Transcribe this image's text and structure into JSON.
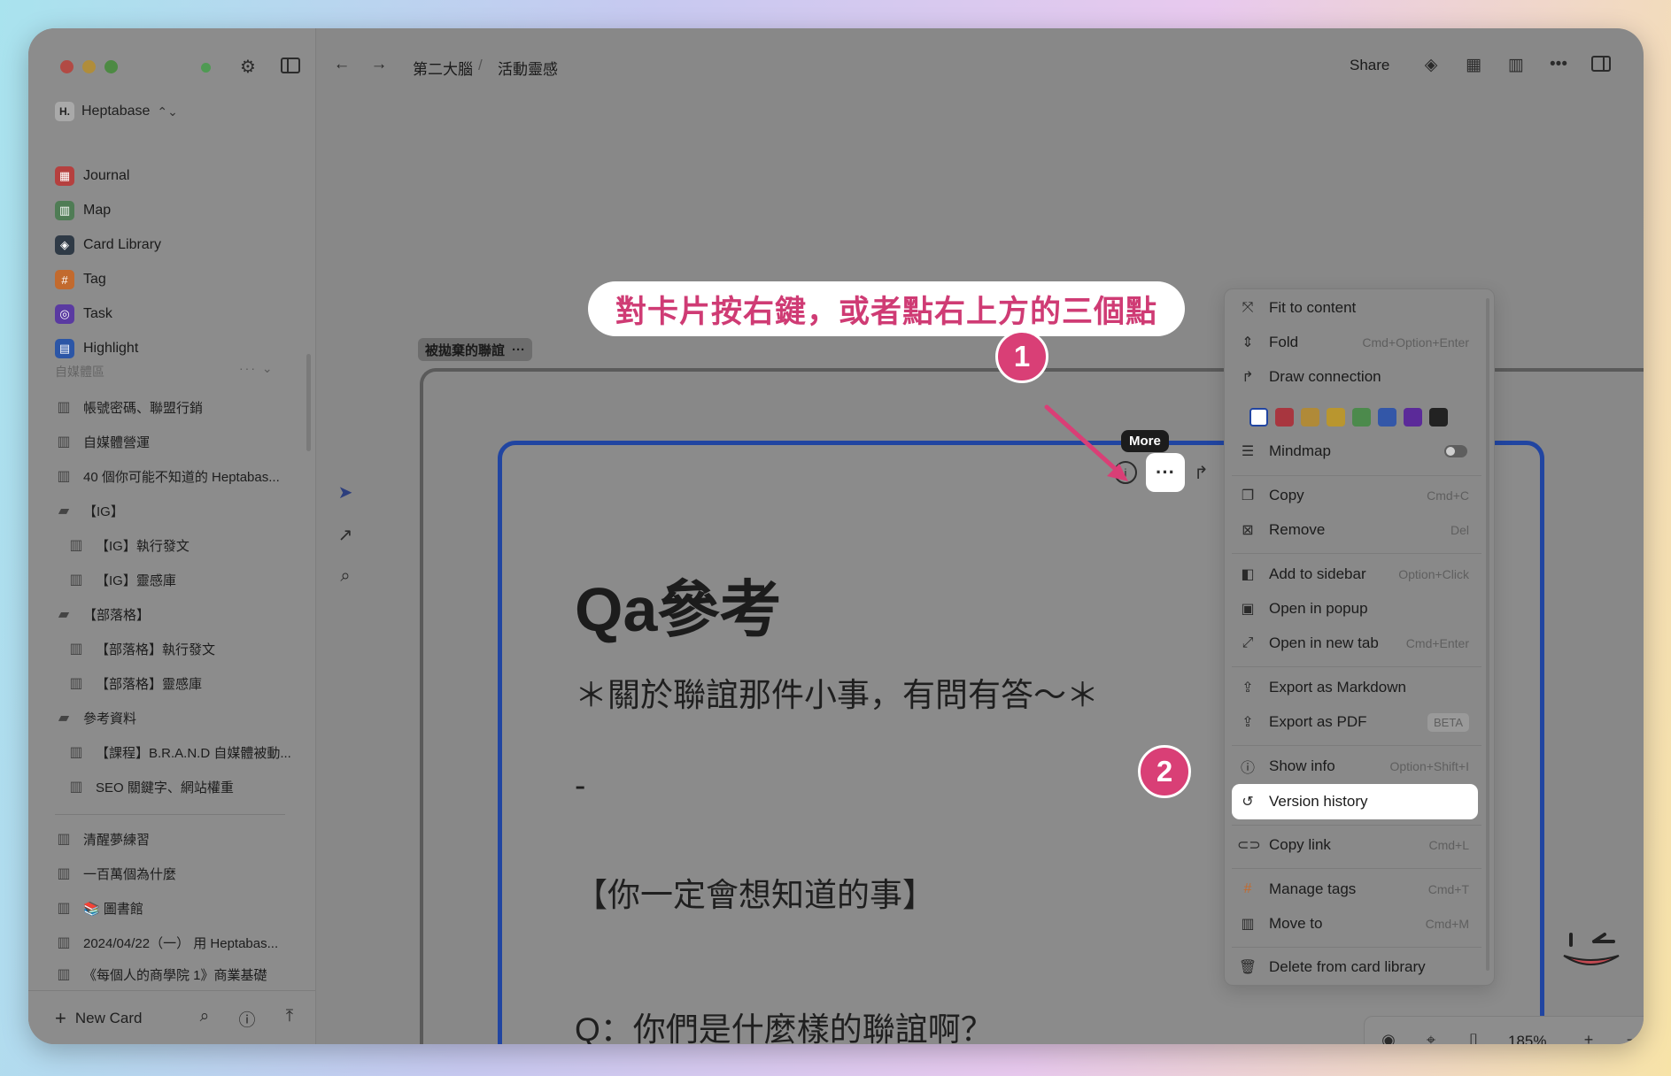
{
  "sidebar": {
    "workspace": {
      "logo": "H.",
      "name": "Heptabase"
    },
    "nav": [
      {
        "label": "Journal",
        "icon": "calendar-icon",
        "color": "#b5403f"
      },
      {
        "label": "Map",
        "icon": "map-icon",
        "color": "#4f7c55"
      },
      {
        "label": "Card Library",
        "icon": "layers-icon",
        "color": "#2f3a46"
      },
      {
        "label": "Tag",
        "icon": "hash-icon",
        "color": "#c26a2e"
      },
      {
        "label": "Task",
        "icon": "check-circle-icon",
        "color": "#5a3aa1"
      },
      {
        "label": "Highlight",
        "icon": "highlight-icon",
        "color": "#2c56a6"
      }
    ],
    "section_title": "自媒體區",
    "section_tools": "···",
    "tree": [
      {
        "label": "帳號密碼、聯盟行銷",
        "type": "card"
      },
      {
        "label": "自媒體營運",
        "type": "card"
      },
      {
        "label": "40 個你可能不知道的 Heptabas...",
        "type": "card"
      },
      {
        "label": "【IG】",
        "type": "folder"
      },
      {
        "label": "【IG】執行發文",
        "type": "card"
      },
      {
        "label": "【IG】靈感庫",
        "type": "card"
      },
      {
        "label": "【部落格】",
        "type": "folder"
      },
      {
        "label": "【部落格】執行發文",
        "type": "card"
      },
      {
        "label": "【部落格】靈感庫",
        "type": "card"
      },
      {
        "label": "參考資料",
        "type": "folder"
      },
      {
        "label": "【課程】B.R.A.N.D 自媒體被動...",
        "type": "card"
      },
      {
        "label": "SEO 關鍵字、網站權重",
        "type": "card"
      },
      {
        "label": "清醒夢練習",
        "type": "card"
      },
      {
        "label": "一百萬個為什麼",
        "type": "card"
      },
      {
        "label": "📚 圖書館",
        "type": "card"
      },
      {
        "label": "2024/04/22（一） 用 Heptabas...",
        "type": "card"
      },
      {
        "label": "《每個人的商學院 1》商業基礎",
        "type": "card"
      }
    ],
    "footer": {
      "new_card": "New Card"
    }
  },
  "header": {
    "breadcrumb": [
      "第二大腦",
      "活動靈感"
    ],
    "breadcrumb_sep": "/",
    "share": "Share"
  },
  "canvas": {
    "banner": "對卡片按右鍵，或者點右上方的三個點",
    "group_label": "被拋棄的聯誼",
    "group_more": "···",
    "card": {
      "title": "Qa參考",
      "lines": [
        "＊關於聯誼那件小事，有問有答～＊",
        "-",
        "【你一定會想知道的事】",
        "Q：你們是什麼樣的聯誼啊？"
      ]
    },
    "tooltip": "More",
    "more_glyph": "···",
    "callouts": [
      "1",
      "2"
    ]
  },
  "context_menu": {
    "items": [
      {
        "label": "Fit to content",
        "shortcut": "",
        "icon": "fit-icon"
      },
      {
        "label": "Fold",
        "shortcut": "Cmd+Option+Enter",
        "icon": "fold-icon"
      },
      {
        "label": "Draw connection",
        "shortcut": "",
        "icon": "connection-icon"
      },
      {
        "label": "Mindmap",
        "shortcut": "",
        "icon": "mindmap-icon"
      },
      {
        "label": "Copy",
        "shortcut": "Cmd+C",
        "icon": "copy-icon"
      },
      {
        "label": "Remove",
        "shortcut": "Del",
        "icon": "remove-icon"
      },
      {
        "label": "Add to sidebar",
        "shortcut": "Option+Click",
        "icon": "sidebar-add-icon"
      },
      {
        "label": "Open in popup",
        "shortcut": "",
        "icon": "popup-icon"
      },
      {
        "label": "Open in new tab",
        "shortcut": "Cmd+Enter",
        "icon": "expand-icon"
      },
      {
        "label": "Export as Markdown",
        "shortcut": "",
        "icon": "export-icon"
      },
      {
        "label": "Export as PDF",
        "badge": "BETA",
        "icon": "export-icon"
      },
      {
        "label": "Show info",
        "shortcut": "Option+Shift+I",
        "icon": "info-icon"
      },
      {
        "label": "Version history",
        "shortcut": "",
        "icon": "history-icon"
      },
      {
        "label": "Copy link",
        "shortcut": "Cmd+L",
        "icon": "link-icon"
      },
      {
        "label": "Manage tags",
        "shortcut": "Cmd+T",
        "icon": "hash-icon"
      },
      {
        "label": "Move to",
        "shortcut": "Cmd+M",
        "icon": "move-icon"
      },
      {
        "label": "Delete from card library",
        "shortcut": "",
        "icon": "trash-icon"
      }
    ],
    "colors": [
      "#ffffff",
      "#a8363f",
      "#b08a38",
      "#b9962f",
      "#4c8a4c",
      "#3357a8",
      "#5b2a99",
      "#222222"
    ]
  },
  "zoom": {
    "level": "185%"
  }
}
